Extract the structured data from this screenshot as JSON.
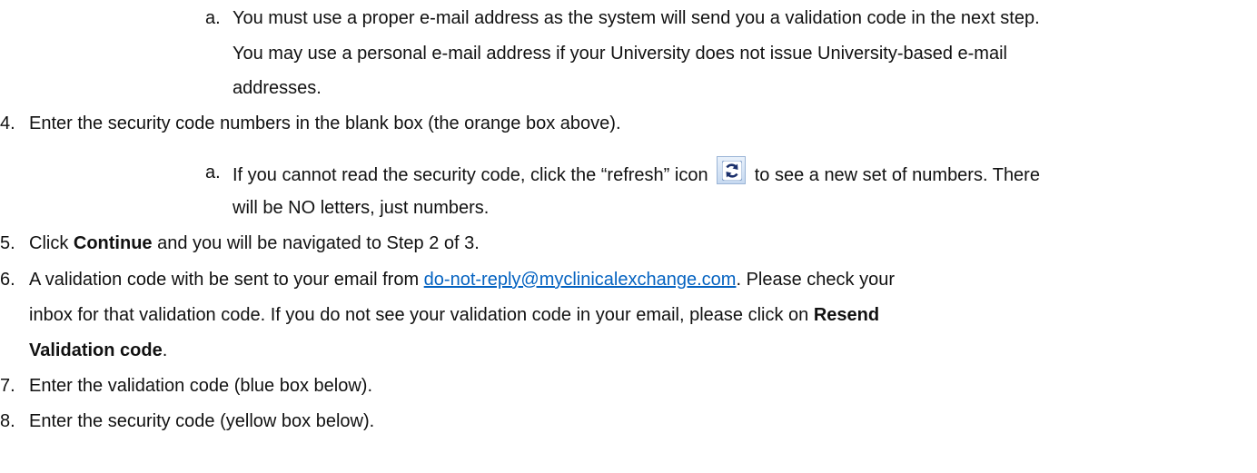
{
  "item3a": {
    "marker": "a.",
    "line1": "You must use a proper e-mail address as the system will send you a validation code in the next step.",
    "line2": "You may use a personal e-mail address if your University does not issue University-based e-mail",
    "line3": "addresses."
  },
  "item4": {
    "marker": "4.",
    "text": "Enter the security code numbers in the blank box (the orange box above)."
  },
  "item4a": {
    "marker": "a.",
    "before_icon": "If you cannot read the security code, click the “refresh” icon",
    "icon": "refresh-icon",
    "after_icon": "to see a new set of numbers.  There",
    "line2": "will be NO letters, just numbers."
  },
  "item5": {
    "marker": "5.",
    "before_bold": "Click ",
    "bold": "Continue",
    "after_bold": " and you will be navigated to Step 2 of 3."
  },
  "item6": {
    "marker": "6.",
    "before_link": "A validation code with be sent to your email from ",
    "link": "do-not-reply@myclinicalexchange.com",
    "after_link": ".  Please check your",
    "line2_before_bold": "inbox for that validation code.  If you do not see your validation code in your email, please click on ",
    "line2_bold": "Resend",
    "line3_bold": "Validation code",
    "line3_after": "."
  },
  "item7": {
    "marker": "7.",
    "text": "Enter the validation code (blue box below)."
  },
  "item8": {
    "marker": "8.",
    "text": "Enter the security code (yellow box below)."
  },
  "colors": {
    "link": "#0563c1",
    "text": "#111111",
    "icon_bg": "#c6d9f0",
    "icon_arrows": "#1a2f6b"
  }
}
